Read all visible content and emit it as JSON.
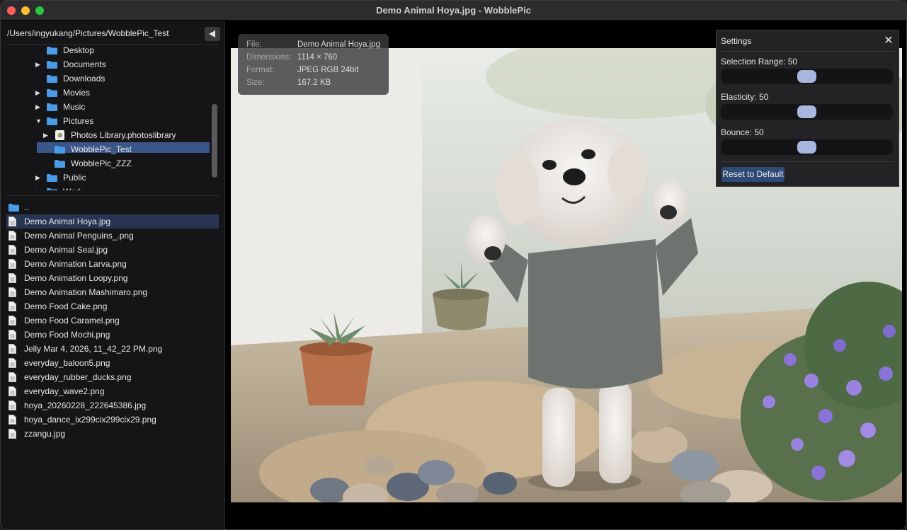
{
  "window": {
    "title": "Demo Animal Hoya.jpg - WobblePic"
  },
  "sidebar": {
    "path": "/Users/ingyukang/Pictures/WobblePic_Test",
    "back_icon": "triangle-left-icon",
    "tree": [
      {
        "label": "Desktop",
        "arrow": ""
      },
      {
        "label": "Documents",
        "arrow": "▶"
      },
      {
        "label": "Downloads",
        "arrow": ""
      },
      {
        "label": "Movies",
        "arrow": "▶"
      },
      {
        "label": "Music",
        "arrow": "▶"
      },
      {
        "label": "Pictures",
        "arrow": "▼"
      },
      {
        "label": "Photos Library.photoslibrary",
        "arrow": "▶"
      },
      {
        "label": "WobblePic_Test",
        "arrow": "",
        "selected": true
      },
      {
        "label": "WobblePic_ZZZ",
        "arrow": ""
      },
      {
        "label": "Public",
        "arrow": "▶"
      },
      {
        "label": "Work",
        "arrow": "▶"
      }
    ],
    "files": [
      {
        "label": "..",
        "type": "folder"
      },
      {
        "label": "Demo Animal Hoya.jpg",
        "type": "file",
        "selected": true
      },
      {
        "label": "Demo Animal Penguins_.png",
        "type": "file"
      },
      {
        "label": "Demo Animal Seal.jpg",
        "type": "file"
      },
      {
        "label": "Demo Animation Larva.png",
        "type": "file"
      },
      {
        "label": "Demo Animation Loopy.png",
        "type": "file"
      },
      {
        "label": "Demo Animation Mashimaro.png",
        "type": "file"
      },
      {
        "label": "Demo Food Cake.png",
        "type": "file"
      },
      {
        "label": "Demo Food Caramel.png",
        "type": "file"
      },
      {
        "label": "Demo Food Mochi.png",
        "type": "file"
      },
      {
        "label": "Jelly Mar 4, 2026, 11_42_22 PM.png",
        "type": "file"
      },
      {
        "label": "everyday_baloon5.png",
        "type": "file"
      },
      {
        "label": "everyday_rubber_ducks.png",
        "type": "file"
      },
      {
        "label": "everyday_wave2.png",
        "type": "file"
      },
      {
        "label": "hoya_20260228_222645386.jpg",
        "type": "file"
      },
      {
        "label": "hoya_dance_ix299cix299cix29.png",
        "type": "file"
      },
      {
        "label": "zzangu.jpg",
        "type": "file"
      }
    ]
  },
  "info": {
    "file_key": "File:",
    "file_val": "Demo Animal Hoya.jpg",
    "dim_key": "Dimensions:",
    "dim_val": "1114 × 760",
    "format_key": "Format:",
    "format_val": "JPEG RGB 24bit",
    "size_key": "Size:",
    "size_val": "167.2 KB"
  },
  "settings": {
    "title": "Settings",
    "close_glyph": "✕",
    "selection_label": "Selection Range: 50",
    "selection_value": 50,
    "elasticity_label": "Elasticity: 50",
    "elasticity_value": 50,
    "bounce_label": "Bounce: 50",
    "bounce_value": 50,
    "reset_label": "Reset to Default"
  },
  "colors": {
    "folder": "#4a9be8",
    "selection": "#3a5588",
    "accent_thumb": "#a9b6e0",
    "reset_button": "#2e4a77"
  }
}
